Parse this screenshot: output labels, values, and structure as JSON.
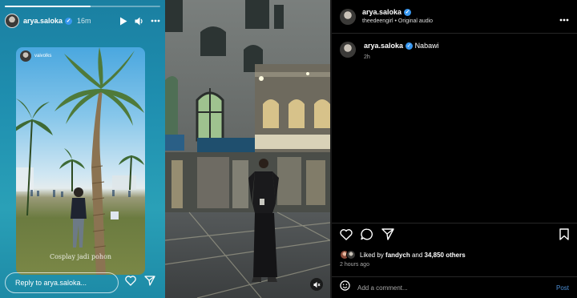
{
  "story": {
    "username": "arya.saloka",
    "time": "16m",
    "progress_fraction": 0.55,
    "card": {
      "username": "vaivolks",
      "caption": "Cosplay jadi pohon"
    },
    "reply_placeholder": "Reply to arya.saloka..."
  },
  "post": {
    "username": "arya.saloka",
    "audio": "theedeengirl • Original audio",
    "caption_user": "arya.saloka",
    "caption_text": "Nabawi",
    "caption_time": "2h",
    "liked_by_prefix": "Liked by ",
    "liked_by_user": "fandych",
    "liked_by_mid": " and ",
    "liked_by_count": "34,850 others",
    "post_time": "2 hours ago",
    "comment_placeholder": "Add a comment...",
    "post_button": "Post"
  },
  "colors": {
    "verified": "#3897f0",
    "link": "#4c8fd6",
    "divider": "#262626"
  },
  "icons": [
    "play-icon",
    "volume-icon",
    "more-icon",
    "heart-icon",
    "send-icon",
    "comment-icon",
    "bookmark-icon",
    "mute-icon"
  ]
}
